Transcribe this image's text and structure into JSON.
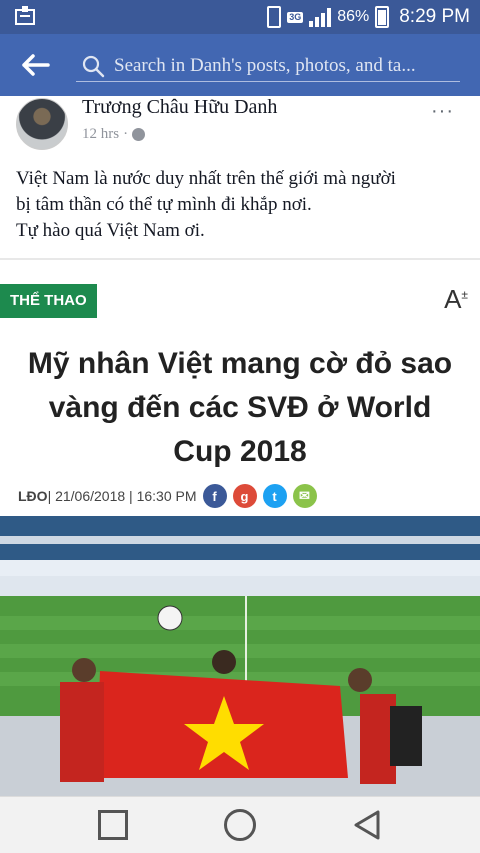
{
  "status_bar": {
    "network": "3G",
    "battery": "86%",
    "time": "8:29 PM",
    "signal_bars": 4
  },
  "search": {
    "placeholder": "Search in Danh's posts, photos, and ta..."
  },
  "post": {
    "author": "Trương Châu Hữu Danh",
    "time": "12 hrs",
    "separator": "·",
    "more": "···",
    "text_lines": [
      "Việt Nam là nước duy nhất trên thế giới mà người",
      "bị tâm thần có thể tự mình đi khắp nơi.",
      "Tự hào quá Việt Nam ơi."
    ]
  },
  "article": {
    "category": "THỂ THAO",
    "font_button": "A",
    "font_button_sup": "±",
    "headline": "Mỹ nhân Việt mang cờ đỏ sao vàng đến các SVĐ ở World Cup 2018",
    "source": "LĐO",
    "date": " | 21/06/2018 | 16:30 PM",
    "share": [
      {
        "name": "facebook-share-icon",
        "glyph": "f",
        "color": "#3b5998"
      },
      {
        "name": "google-plus-share-icon",
        "glyph": "g",
        "color": "#dd4b39"
      },
      {
        "name": "twitter-share-icon",
        "glyph": "t",
        "color": "#1da1f2"
      },
      {
        "name": "email-share-icon",
        "glyph": "✉",
        "color": "#8bc34a"
      }
    ]
  },
  "colors": {
    "fb_blue": "#4267b2",
    "status_blue": "#3b5998",
    "category_green": "#1d8a4e",
    "flag_red": "#da251d",
    "flag_star": "#ffdd00"
  }
}
